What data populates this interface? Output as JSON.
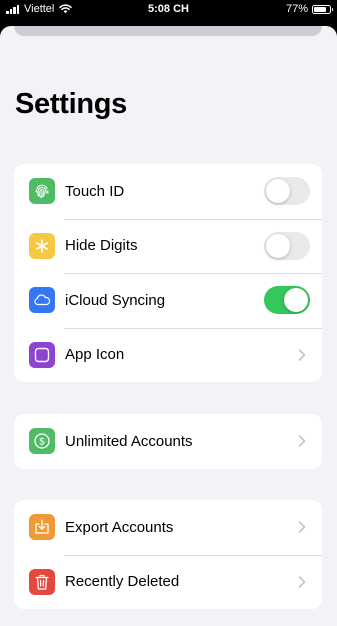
{
  "status_bar": {
    "carrier": "Viettel",
    "time": "5:08 CH",
    "battery": "77%",
    "battery_level": 0.77
  },
  "page": {
    "title": "Settings"
  },
  "groups": [
    {
      "rows": [
        {
          "label": "Touch ID",
          "icon": "touch-id-icon",
          "icon_color": "#4fbb64",
          "control": "toggle",
          "on": false
        },
        {
          "label": "Hide Digits",
          "icon": "asterisk-icon",
          "icon_color": "#f6c944",
          "control": "toggle",
          "on": false
        },
        {
          "label": "iCloud Syncing",
          "icon": "cloud-icon",
          "icon_color": "#3477f5",
          "control": "toggle",
          "on": true
        },
        {
          "label": "App Icon",
          "icon": "app-icon-square",
          "icon_color": "#8e44cf",
          "control": "chevron"
        }
      ]
    },
    {
      "rows": [
        {
          "label": "Unlimited Accounts",
          "icon": "dollar-icon",
          "icon_color": "#4fbb64",
          "control": "chevron"
        }
      ]
    },
    {
      "rows": [
        {
          "label": "Export Accounts",
          "icon": "export-icon",
          "icon_color": "#f09a33",
          "control": "chevron"
        },
        {
          "label": "Recently Deleted",
          "icon": "trash-icon",
          "icon_color": "#e5483d",
          "control": "chevron"
        }
      ]
    }
  ],
  "colors": {
    "toggle_on": "#34c759",
    "toggle_off": "#e9e9eb",
    "background": "#f2f2f7",
    "chevron": "#c4c4c6"
  }
}
